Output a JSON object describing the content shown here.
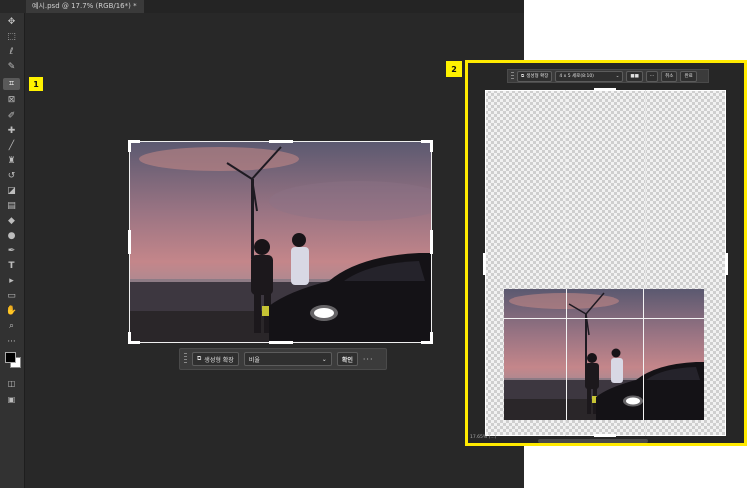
{
  "document": {
    "tab_label": "예시.psd @ 17.7% (RGB/16*) *"
  },
  "badges": {
    "left": "1",
    "right": "2"
  },
  "tools": [
    {
      "name": "move-tool",
      "glyph": "✥"
    },
    {
      "name": "marquee-tool",
      "glyph": "⬚"
    },
    {
      "name": "lasso-tool",
      "glyph": "ℓ"
    },
    {
      "name": "quick-select-tool",
      "glyph": "✎"
    },
    {
      "name": "crop-tool",
      "glyph": "⌗"
    },
    {
      "name": "frame-tool",
      "glyph": "⊠"
    },
    {
      "name": "eyedropper-tool",
      "glyph": "✐"
    },
    {
      "name": "healing-brush-tool",
      "glyph": "✚"
    },
    {
      "name": "brush-tool",
      "glyph": "╱"
    },
    {
      "name": "stamp-tool",
      "glyph": "♜"
    },
    {
      "name": "history-brush-tool",
      "glyph": "↺"
    },
    {
      "name": "eraser-tool",
      "glyph": "◪"
    },
    {
      "name": "gradient-tool",
      "glyph": "▤"
    },
    {
      "name": "blur-tool",
      "glyph": "◆"
    },
    {
      "name": "dodge-tool",
      "glyph": "●"
    },
    {
      "name": "pen-tool",
      "glyph": "✒"
    },
    {
      "name": "type-tool",
      "glyph": "T"
    },
    {
      "name": "path-select-tool",
      "glyph": "▸"
    },
    {
      "name": "shape-tool",
      "glyph": "▭"
    },
    {
      "name": "hand-tool",
      "glyph": "✋"
    },
    {
      "name": "zoom-tool",
      "glyph": "⌕"
    },
    {
      "name": "more-tools",
      "glyph": "···"
    }
  ],
  "crop_toolbar": {
    "generative_expand_label": "생성형 확장",
    "ratio_value": "비율",
    "ratio_chevron": "⌄",
    "ok_label": "확인",
    "more_glyph": "···"
  },
  "right_panel": {
    "generative_expand_label": "생성형 확장",
    "ratio_value": "4 x 5 세로(8:10)",
    "ratio_chevron": "⌄",
    "action1_label": "■■",
    "more_glyph": "···",
    "cancel_label": "취소",
    "done_label": "완료",
    "status_text": "17.65% (...)"
  },
  "colors": {
    "highlight": "#fff200",
    "panel_bg": "#282828",
    "toolbar_bg": "#323232"
  }
}
